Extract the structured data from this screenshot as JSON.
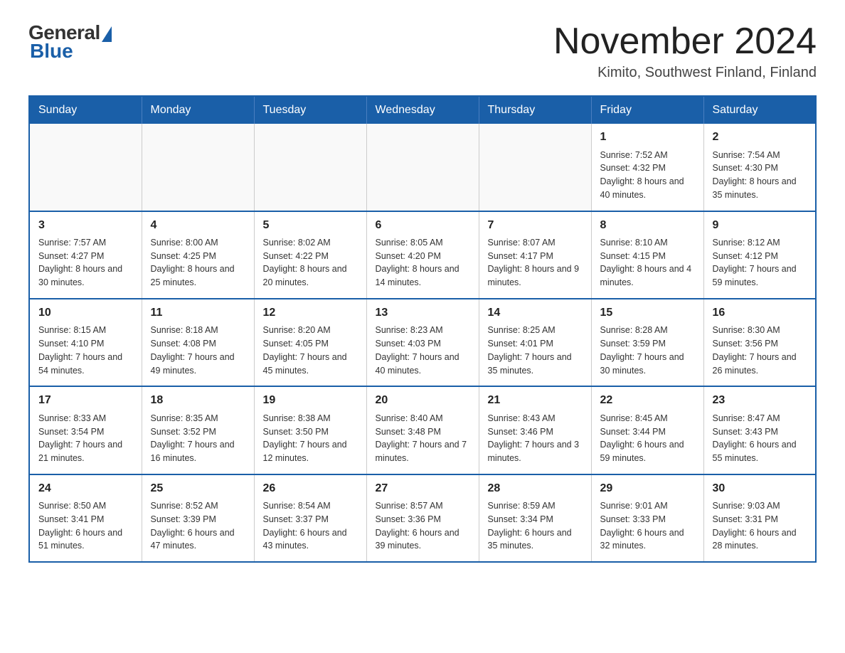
{
  "header": {
    "logo_general": "General",
    "logo_blue": "Blue",
    "title": "November 2024",
    "location": "Kimito, Southwest Finland, Finland"
  },
  "calendar": {
    "days_of_week": [
      "Sunday",
      "Monday",
      "Tuesday",
      "Wednesday",
      "Thursday",
      "Friday",
      "Saturday"
    ],
    "weeks": [
      [
        {
          "day": "",
          "info": ""
        },
        {
          "day": "",
          "info": ""
        },
        {
          "day": "",
          "info": ""
        },
        {
          "day": "",
          "info": ""
        },
        {
          "day": "",
          "info": ""
        },
        {
          "day": "1",
          "info": "Sunrise: 7:52 AM\nSunset: 4:32 PM\nDaylight: 8 hours\nand 40 minutes."
        },
        {
          "day": "2",
          "info": "Sunrise: 7:54 AM\nSunset: 4:30 PM\nDaylight: 8 hours\nand 35 minutes."
        }
      ],
      [
        {
          "day": "3",
          "info": "Sunrise: 7:57 AM\nSunset: 4:27 PM\nDaylight: 8 hours\nand 30 minutes."
        },
        {
          "day": "4",
          "info": "Sunrise: 8:00 AM\nSunset: 4:25 PM\nDaylight: 8 hours\nand 25 minutes."
        },
        {
          "day": "5",
          "info": "Sunrise: 8:02 AM\nSunset: 4:22 PM\nDaylight: 8 hours\nand 20 minutes."
        },
        {
          "day": "6",
          "info": "Sunrise: 8:05 AM\nSunset: 4:20 PM\nDaylight: 8 hours\nand 14 minutes."
        },
        {
          "day": "7",
          "info": "Sunrise: 8:07 AM\nSunset: 4:17 PM\nDaylight: 8 hours\nand 9 minutes."
        },
        {
          "day": "8",
          "info": "Sunrise: 8:10 AM\nSunset: 4:15 PM\nDaylight: 8 hours\nand 4 minutes."
        },
        {
          "day": "9",
          "info": "Sunrise: 8:12 AM\nSunset: 4:12 PM\nDaylight: 7 hours\nand 59 minutes."
        }
      ],
      [
        {
          "day": "10",
          "info": "Sunrise: 8:15 AM\nSunset: 4:10 PM\nDaylight: 7 hours\nand 54 minutes."
        },
        {
          "day": "11",
          "info": "Sunrise: 8:18 AM\nSunset: 4:08 PM\nDaylight: 7 hours\nand 49 minutes."
        },
        {
          "day": "12",
          "info": "Sunrise: 8:20 AM\nSunset: 4:05 PM\nDaylight: 7 hours\nand 45 minutes."
        },
        {
          "day": "13",
          "info": "Sunrise: 8:23 AM\nSunset: 4:03 PM\nDaylight: 7 hours\nand 40 minutes."
        },
        {
          "day": "14",
          "info": "Sunrise: 8:25 AM\nSunset: 4:01 PM\nDaylight: 7 hours\nand 35 minutes."
        },
        {
          "day": "15",
          "info": "Sunrise: 8:28 AM\nSunset: 3:59 PM\nDaylight: 7 hours\nand 30 minutes."
        },
        {
          "day": "16",
          "info": "Sunrise: 8:30 AM\nSunset: 3:56 PM\nDaylight: 7 hours\nand 26 minutes."
        }
      ],
      [
        {
          "day": "17",
          "info": "Sunrise: 8:33 AM\nSunset: 3:54 PM\nDaylight: 7 hours\nand 21 minutes."
        },
        {
          "day": "18",
          "info": "Sunrise: 8:35 AM\nSunset: 3:52 PM\nDaylight: 7 hours\nand 16 minutes."
        },
        {
          "day": "19",
          "info": "Sunrise: 8:38 AM\nSunset: 3:50 PM\nDaylight: 7 hours\nand 12 minutes."
        },
        {
          "day": "20",
          "info": "Sunrise: 8:40 AM\nSunset: 3:48 PM\nDaylight: 7 hours\nand 7 minutes."
        },
        {
          "day": "21",
          "info": "Sunrise: 8:43 AM\nSunset: 3:46 PM\nDaylight: 7 hours\nand 3 minutes."
        },
        {
          "day": "22",
          "info": "Sunrise: 8:45 AM\nSunset: 3:44 PM\nDaylight: 6 hours\nand 59 minutes."
        },
        {
          "day": "23",
          "info": "Sunrise: 8:47 AM\nSunset: 3:43 PM\nDaylight: 6 hours\nand 55 minutes."
        }
      ],
      [
        {
          "day": "24",
          "info": "Sunrise: 8:50 AM\nSunset: 3:41 PM\nDaylight: 6 hours\nand 51 minutes."
        },
        {
          "day": "25",
          "info": "Sunrise: 8:52 AM\nSunset: 3:39 PM\nDaylight: 6 hours\nand 47 minutes."
        },
        {
          "day": "26",
          "info": "Sunrise: 8:54 AM\nSunset: 3:37 PM\nDaylight: 6 hours\nand 43 minutes."
        },
        {
          "day": "27",
          "info": "Sunrise: 8:57 AM\nSunset: 3:36 PM\nDaylight: 6 hours\nand 39 minutes."
        },
        {
          "day": "28",
          "info": "Sunrise: 8:59 AM\nSunset: 3:34 PM\nDaylight: 6 hours\nand 35 minutes."
        },
        {
          "day": "29",
          "info": "Sunrise: 9:01 AM\nSunset: 3:33 PM\nDaylight: 6 hours\nand 32 minutes."
        },
        {
          "day": "30",
          "info": "Sunrise: 9:03 AM\nSunset: 3:31 PM\nDaylight: 6 hours\nand 28 minutes."
        }
      ]
    ]
  }
}
